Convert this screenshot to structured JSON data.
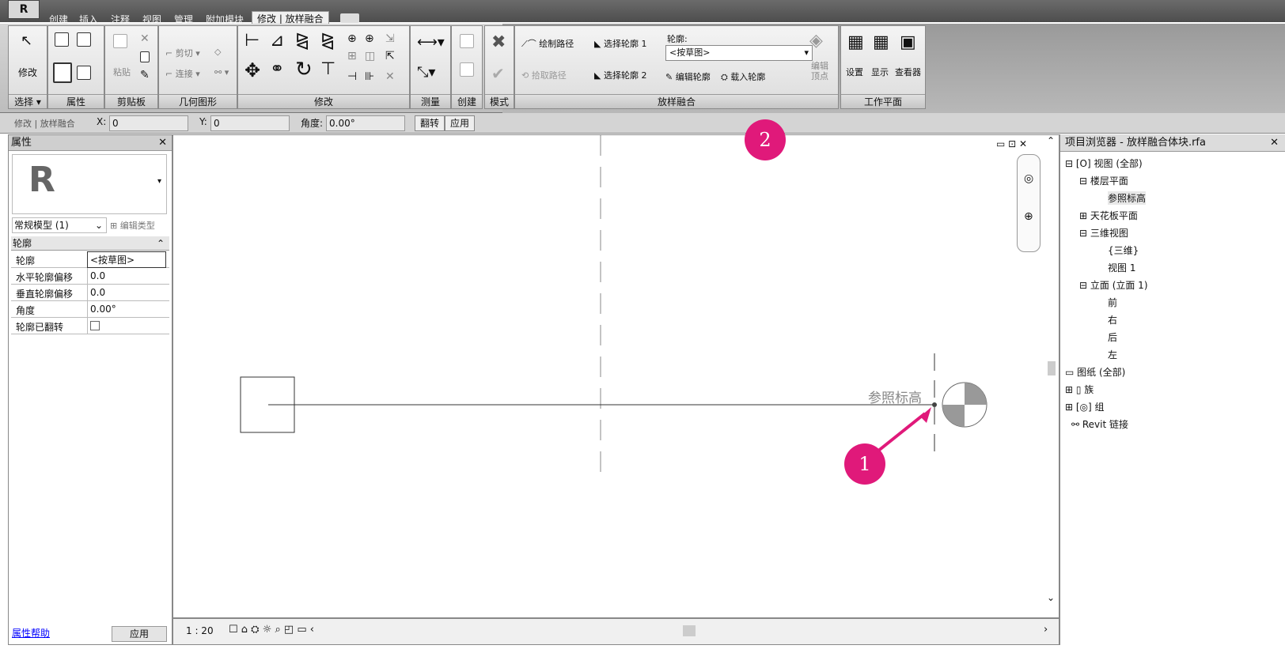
{
  "tabs": [
    "创建",
    "插入",
    "注释",
    "视图",
    "管理",
    "附加模块",
    "修改 | 放样融合"
  ],
  "app_button": "R",
  "ribbon": {
    "modify_label": "修改",
    "panels": [
      "选择 ▾",
      "属性",
      "剪贴板",
      "几何图形",
      "修改",
      "测量",
      "创建",
      "模式",
      "放样融合",
      "工作平面"
    ],
    "clipboard": {
      "paste": "粘贴"
    },
    "geometry": {
      "cut": "剪切",
      "join": "连接"
    },
    "path": {
      "draw": "绘制路径",
      "pick": "拾取路径"
    },
    "profile": {
      "select1": "选择轮廓 1",
      "select2": "选择轮廓 2",
      "profile_label": "轮廓:",
      "profile_value": "<按草图>",
      "edit": "编辑轮廓",
      "load": "载入轮廓",
      "edit_vertex": "编辑顶点"
    },
    "workplane": {
      "set": "设置",
      "show": "显示",
      "viewer": "查看器"
    }
  },
  "options_bar": {
    "context": "修改 | 放样融合",
    "x_label": "X:",
    "x_value": "0",
    "y_label": "Y:",
    "y_value": "0",
    "angle_label": "角度:",
    "angle_value": "0.00°",
    "flip": "翻转",
    "apply": "应用"
  },
  "properties": {
    "title": "属性",
    "type_selector": "常规模型 (1)",
    "edit_type": "编辑类型",
    "group": "轮廓",
    "rows": [
      {
        "key": "轮廓",
        "value": "<按草图>"
      },
      {
        "key": "水平轮廓偏移",
        "value": "0.0"
      },
      {
        "key": "垂直轮廓偏移",
        "value": "0.0"
      },
      {
        "key": "角度",
        "value": "0.00°"
      },
      {
        "key": "轮廓已翻转",
        "value": ""
      }
    ],
    "help": "属性帮助",
    "apply": "应用"
  },
  "canvas": {
    "level_label": "参照标高",
    "scale": "1 : 20"
  },
  "browser": {
    "title": "项目浏览器 - 放样融合体块.rfa",
    "items": [
      "视图 (全部)",
      "楼层平面",
      "参照标高",
      "天花板平面",
      "三维视图",
      "{三维}",
      "视图 1",
      "立面 (立面 1)",
      "前",
      "右",
      "后",
      "左",
      "图纸 (全部)",
      "族",
      "组",
      "Revit 链接"
    ]
  },
  "callouts": [
    "1",
    "2"
  ],
  "colors": {
    "callout": "#e0197a",
    "ribbon_dark": "#9a9a9a"
  }
}
